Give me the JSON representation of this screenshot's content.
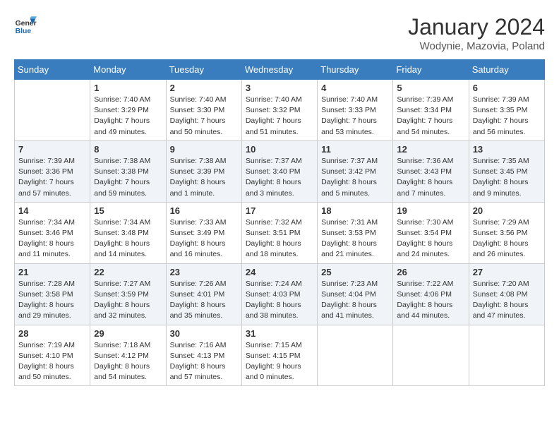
{
  "header": {
    "logo_line1": "General",
    "logo_line2": "Blue",
    "month": "January 2024",
    "location": "Wodynie, Mazovia, Poland"
  },
  "weekdays": [
    "Sunday",
    "Monday",
    "Tuesday",
    "Wednesday",
    "Thursday",
    "Friday",
    "Saturday"
  ],
  "weeks": [
    [
      {
        "day": "",
        "info": ""
      },
      {
        "day": "1",
        "info": "Sunrise: 7:40 AM\nSunset: 3:29 PM\nDaylight: 7 hours\nand 49 minutes."
      },
      {
        "day": "2",
        "info": "Sunrise: 7:40 AM\nSunset: 3:30 PM\nDaylight: 7 hours\nand 50 minutes."
      },
      {
        "day": "3",
        "info": "Sunrise: 7:40 AM\nSunset: 3:32 PM\nDaylight: 7 hours\nand 51 minutes."
      },
      {
        "day": "4",
        "info": "Sunrise: 7:40 AM\nSunset: 3:33 PM\nDaylight: 7 hours\nand 53 minutes."
      },
      {
        "day": "5",
        "info": "Sunrise: 7:39 AM\nSunset: 3:34 PM\nDaylight: 7 hours\nand 54 minutes."
      },
      {
        "day": "6",
        "info": "Sunrise: 7:39 AM\nSunset: 3:35 PM\nDaylight: 7 hours\nand 56 minutes."
      }
    ],
    [
      {
        "day": "7",
        "info": "Sunrise: 7:39 AM\nSunset: 3:36 PM\nDaylight: 7 hours\nand 57 minutes."
      },
      {
        "day": "8",
        "info": "Sunrise: 7:38 AM\nSunset: 3:38 PM\nDaylight: 7 hours\nand 59 minutes."
      },
      {
        "day": "9",
        "info": "Sunrise: 7:38 AM\nSunset: 3:39 PM\nDaylight: 8 hours\nand 1 minute."
      },
      {
        "day": "10",
        "info": "Sunrise: 7:37 AM\nSunset: 3:40 PM\nDaylight: 8 hours\nand 3 minutes."
      },
      {
        "day": "11",
        "info": "Sunrise: 7:37 AM\nSunset: 3:42 PM\nDaylight: 8 hours\nand 5 minutes."
      },
      {
        "day": "12",
        "info": "Sunrise: 7:36 AM\nSunset: 3:43 PM\nDaylight: 8 hours\nand 7 minutes."
      },
      {
        "day": "13",
        "info": "Sunrise: 7:35 AM\nSunset: 3:45 PM\nDaylight: 8 hours\nand 9 minutes."
      }
    ],
    [
      {
        "day": "14",
        "info": "Sunrise: 7:34 AM\nSunset: 3:46 PM\nDaylight: 8 hours\nand 11 minutes."
      },
      {
        "day": "15",
        "info": "Sunrise: 7:34 AM\nSunset: 3:48 PM\nDaylight: 8 hours\nand 14 minutes."
      },
      {
        "day": "16",
        "info": "Sunrise: 7:33 AM\nSunset: 3:49 PM\nDaylight: 8 hours\nand 16 minutes."
      },
      {
        "day": "17",
        "info": "Sunrise: 7:32 AM\nSunset: 3:51 PM\nDaylight: 8 hours\nand 18 minutes."
      },
      {
        "day": "18",
        "info": "Sunrise: 7:31 AM\nSunset: 3:53 PM\nDaylight: 8 hours\nand 21 minutes."
      },
      {
        "day": "19",
        "info": "Sunrise: 7:30 AM\nSunset: 3:54 PM\nDaylight: 8 hours\nand 24 minutes."
      },
      {
        "day": "20",
        "info": "Sunrise: 7:29 AM\nSunset: 3:56 PM\nDaylight: 8 hours\nand 26 minutes."
      }
    ],
    [
      {
        "day": "21",
        "info": "Sunrise: 7:28 AM\nSunset: 3:58 PM\nDaylight: 8 hours\nand 29 minutes."
      },
      {
        "day": "22",
        "info": "Sunrise: 7:27 AM\nSunset: 3:59 PM\nDaylight: 8 hours\nand 32 minutes."
      },
      {
        "day": "23",
        "info": "Sunrise: 7:26 AM\nSunset: 4:01 PM\nDaylight: 8 hours\nand 35 minutes."
      },
      {
        "day": "24",
        "info": "Sunrise: 7:24 AM\nSunset: 4:03 PM\nDaylight: 8 hours\nand 38 minutes."
      },
      {
        "day": "25",
        "info": "Sunrise: 7:23 AM\nSunset: 4:04 PM\nDaylight: 8 hours\nand 41 minutes."
      },
      {
        "day": "26",
        "info": "Sunrise: 7:22 AM\nSunset: 4:06 PM\nDaylight: 8 hours\nand 44 minutes."
      },
      {
        "day": "27",
        "info": "Sunrise: 7:20 AM\nSunset: 4:08 PM\nDaylight: 8 hours\nand 47 minutes."
      }
    ],
    [
      {
        "day": "28",
        "info": "Sunrise: 7:19 AM\nSunset: 4:10 PM\nDaylight: 8 hours\nand 50 minutes."
      },
      {
        "day": "29",
        "info": "Sunrise: 7:18 AM\nSunset: 4:12 PM\nDaylight: 8 hours\nand 54 minutes."
      },
      {
        "day": "30",
        "info": "Sunrise: 7:16 AM\nSunset: 4:13 PM\nDaylight: 8 hours\nand 57 minutes."
      },
      {
        "day": "31",
        "info": "Sunrise: 7:15 AM\nSunset: 4:15 PM\nDaylight: 9 hours\nand 0 minutes."
      },
      {
        "day": "",
        "info": ""
      },
      {
        "day": "",
        "info": ""
      },
      {
        "day": "",
        "info": ""
      }
    ]
  ]
}
